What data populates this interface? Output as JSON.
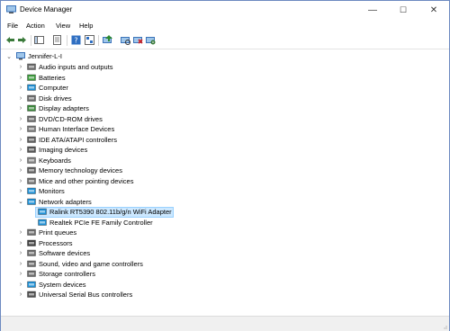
{
  "window": {
    "title": "Device Manager",
    "controls": {
      "minimize": "—",
      "maximize": "☐",
      "close": "✕"
    }
  },
  "menu": [
    "File",
    "Action",
    "View",
    "Help"
  ],
  "toolbar": {
    "icons": [
      "back-arrow-icon",
      "forward-arrow-icon",
      "show-hide-console-tree-icon",
      "properties-sheet-icon",
      "help-icon",
      "devices-by-type-icon",
      "update-driver-icon",
      "disable-device-icon",
      "uninstall-device-icon",
      "scan-hardware-icon"
    ]
  },
  "tree": {
    "root": "Jennifer-L-I",
    "categories": [
      {
        "label": "Audio inputs and outputs",
        "icon": "speaker-icon",
        "color": "#6b6b6b",
        "expanded": false
      },
      {
        "label": "Batteries",
        "icon": "battery-icon",
        "color": "#3c9c3c",
        "expanded": false
      },
      {
        "label": "Computer",
        "icon": "monitor-icon",
        "color": "#1e90d6",
        "expanded": false
      },
      {
        "label": "Disk drives",
        "icon": "disk-drive-icon",
        "color": "#6b6b6b",
        "expanded": false
      },
      {
        "label": "Display adapters",
        "icon": "display-adapter-icon",
        "color": "#3b8a3b",
        "expanded": false
      },
      {
        "label": "DVD/CD-ROM drives",
        "icon": "dvd-drive-icon",
        "color": "#6b6b6b",
        "expanded": false
      },
      {
        "label": "Human Interface Devices",
        "icon": "hid-icon",
        "color": "#7a7a7a",
        "expanded": false
      },
      {
        "label": "IDE ATA/ATAPI controllers",
        "icon": "ide-controller-icon",
        "color": "#5e5e5e",
        "expanded": false
      },
      {
        "label": "Imaging devices",
        "icon": "camera-icon",
        "color": "#555555",
        "expanded": false
      },
      {
        "label": "Keyboards",
        "icon": "keyboard-icon",
        "color": "#808080",
        "expanded": false
      },
      {
        "label": "Memory technology devices",
        "icon": "memory-icon",
        "color": "#606060",
        "expanded": false
      },
      {
        "label": "Mice and other pointing devices",
        "icon": "mouse-icon",
        "color": "#707070",
        "expanded": false
      },
      {
        "label": "Monitors",
        "icon": "monitor-icon",
        "color": "#1e90d6",
        "expanded": false
      },
      {
        "label": "Network adapters",
        "icon": "network-adapter-icon",
        "color": "#1e90d6",
        "expanded": true,
        "children": [
          {
            "label": "Ralink RT5390 802.11b/g/n WiFi Adapter",
            "icon": "network-adapter-icon",
            "selected": true
          },
          {
            "label": "Realtek PCIe FE Family Controller",
            "icon": "network-adapter-icon",
            "selected": false
          }
        ]
      },
      {
        "label": "Print queues",
        "icon": "printer-icon",
        "color": "#6b6b6b",
        "expanded": false
      },
      {
        "label": "Processors",
        "icon": "processor-icon",
        "color": "#404040",
        "expanded": false
      },
      {
        "label": "Software devices",
        "icon": "software-device-icon",
        "color": "#6b6b6b",
        "expanded": false
      },
      {
        "label": "Sound, video and game controllers",
        "icon": "speaker-icon",
        "color": "#6b6b6b",
        "expanded": false
      },
      {
        "label": "Storage controllers",
        "icon": "storage-controller-icon",
        "color": "#6b6b6b",
        "expanded": false
      },
      {
        "label": "System devices",
        "icon": "system-device-icon",
        "color": "#1e90d6",
        "expanded": false
      },
      {
        "label": "Universal Serial Bus controllers",
        "icon": "usb-icon",
        "color": "#505050",
        "expanded": false
      }
    ]
  },
  "colors": {
    "selection_bg": "#cce8ff",
    "selection_border": "#99d1ff",
    "accent": "#1e90d6"
  }
}
